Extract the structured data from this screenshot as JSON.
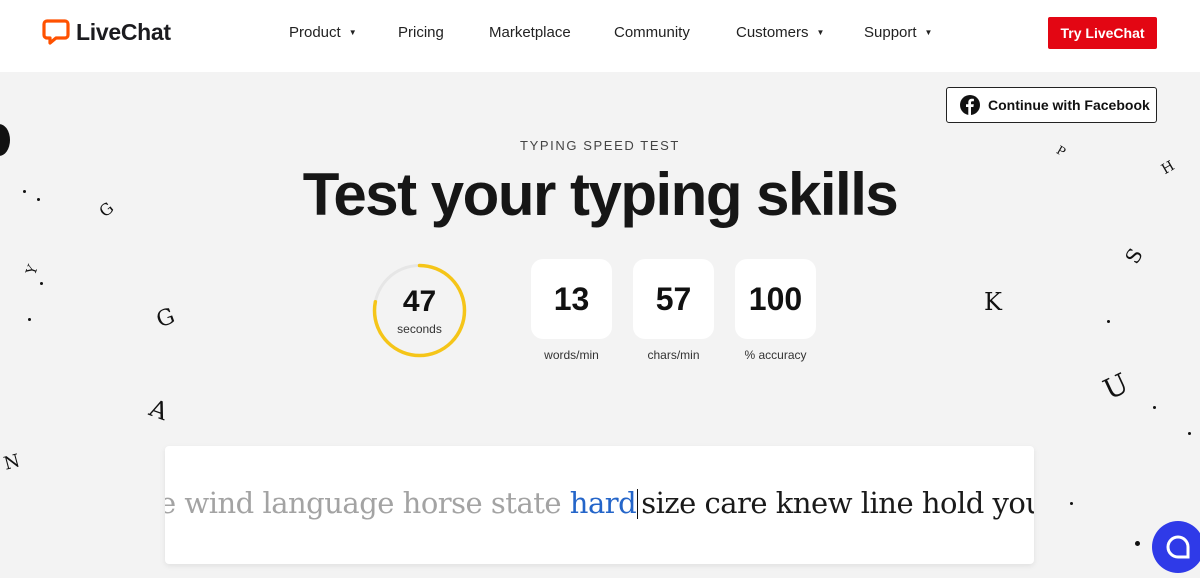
{
  "brand": {
    "name": "LiveChat",
    "color": "#ff5100"
  },
  "nav": {
    "items": [
      {
        "label": "Product",
        "dropdown": true
      },
      {
        "label": "Pricing",
        "dropdown": false
      },
      {
        "label": "Marketplace",
        "dropdown": false
      },
      {
        "label": "Community",
        "dropdown": false
      },
      {
        "label": "Customers",
        "dropdown": true
      },
      {
        "label": "Support",
        "dropdown": true
      }
    ],
    "cta_label": "Try LiveChat",
    "cta_color": "#e30613"
  },
  "auth": {
    "facebook_label": "Continue with Facebook",
    "icon": "facebook-icon"
  },
  "hero": {
    "eyebrow": "TYPING SPEED TEST",
    "title": "Test your typing skills"
  },
  "stats": {
    "timer": {
      "value": "47",
      "unit": "seconds",
      "ring_color": "#f5c518",
      "progress": 0.78
    },
    "words": {
      "value": "13",
      "label": "words/min"
    },
    "chars": {
      "value": "57",
      "label": "chars/min"
    },
    "accuracy": {
      "value": "100",
      "label": "% accuracy"
    }
  },
  "typing": {
    "typed": "e wind language horse state ",
    "current": "hard",
    "upcoming": "size care knew line hold your nir",
    "current_color": "#2465c9"
  },
  "chat_launcher": {
    "icon": "chat-bubble-icon",
    "color": "#2f3ae8"
  }
}
